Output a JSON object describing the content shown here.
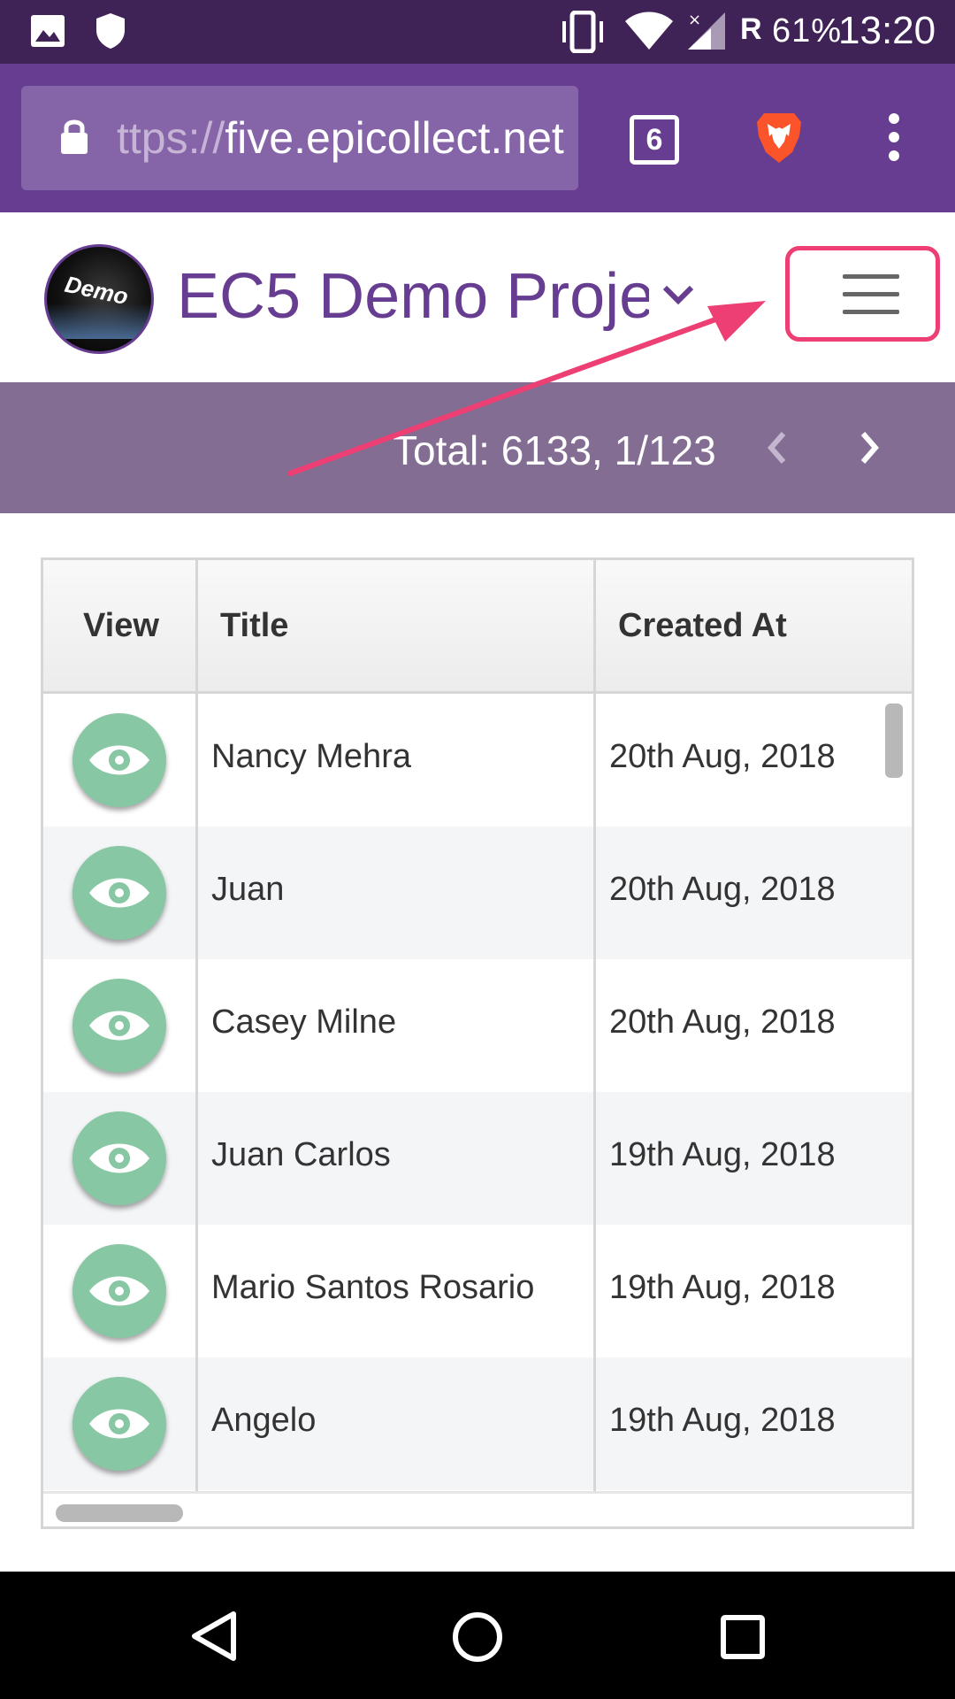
{
  "status_bar": {
    "carrier_indicator": "R",
    "battery": "61%",
    "time": "13:20",
    "icons": [
      "image-icon",
      "shield-icon",
      "vibrate-icon",
      "wifi-icon",
      "signal-icon"
    ]
  },
  "browser": {
    "url_scheme": "ttps://",
    "url_host": "five.epicollect.net",
    "tab_count": "6",
    "icons": [
      "lock-icon",
      "brave-lion-icon",
      "kebab-menu-icon"
    ]
  },
  "header": {
    "avatar_text": "Demo",
    "project_title": "EC5 Demo Proje",
    "accent_color": "#663d91",
    "highlight_color": "#ee3f75"
  },
  "totals": {
    "text": "Total: 6133, 1/123"
  },
  "table": {
    "columns": [
      "View",
      "Title",
      "Created At"
    ],
    "rows": [
      {
        "title": "Nancy Mehra",
        "created_at": "20th Aug, 2018"
      },
      {
        "title": "Juan",
        "created_at": "20th Aug, 2018"
      },
      {
        "title": "Casey Milne",
        "created_at": "20th Aug, 2018"
      },
      {
        "title": "Juan Carlos",
        "created_at": "19th Aug, 2018"
      },
      {
        "title": "Mario Santos Rosario",
        "created_at": "19th Aug, 2018"
      },
      {
        "title": "Angelo",
        "created_at": "19th Aug, 2018"
      }
    ],
    "view_button_color": "#88c7a3"
  }
}
